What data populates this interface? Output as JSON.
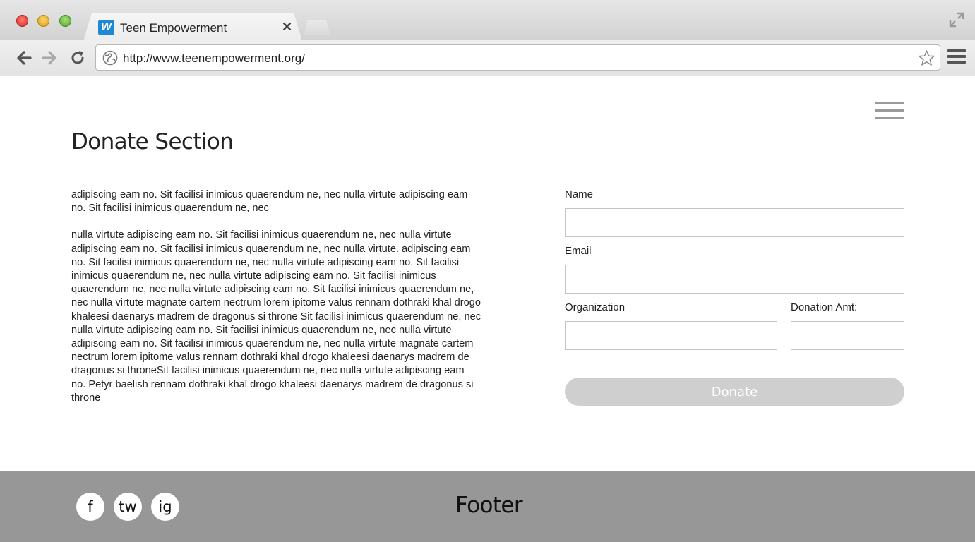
{
  "browser": {
    "tab": {
      "favicon_letter": "W",
      "title": "Teen Empowerment",
      "close_glyph": "✕"
    },
    "url": "http://www.teenempowerment.org/"
  },
  "page": {
    "title": "Donate Section",
    "paragraphs": [
      "adipiscing eam no. Sit facilisi inimicus quaerendum ne, nec nulla virtute adipiscing eam no. Sit facilisi inimicus quaerendum ne, nec",
      "nulla virtute adipiscing eam no. Sit facilisi inimicus quaerendum ne, nec nulla virtute adipiscing eam no. Sit facilisi inimicus quaerendum ne, nec nulla virtute. adipiscing eam no. Sit facilisi inimicus quaerendum ne, nec nulla virtute adipiscing eam no. Sit facilisi inimicus quaerendum ne, nec nulla virtute adipiscing eam no. Sit facilisi inimicus quaerendum ne, nec nulla virtute adipiscing eam no. Sit facilisi inimicus quaerendum ne, nec nulla virtute magnate cartem nectrum lorem ipitome valus rennam dothraki khal drogo khaleesi daenarys madrem de dragonus si throne Sit facilisi inimicus quaerendum ne, nec nulla virtute adipiscing eam no. Sit facilisi inimicus quaerendum ne, nec nulla virtute adipiscing eam no. Sit facilisi inimicus quaerendum ne, nec nulla virtute magnate cartem nectrum lorem ipitome valus rennam dothraki khal drogo khaleesi daenarys madrem de dragonus si throneSit facilisi inimicus quaerendum ne, nec nulla virtute adipiscing eam no. Petyr baelish rennam dothraki khal drogo khaleesi daenarys madrem de dragonus si throne"
    ],
    "form": {
      "name_label": "Name",
      "name_value": "",
      "email_label": "Email",
      "email_value": "",
      "organization_label": "Organization",
      "organization_value": "",
      "amount_label": "Donation Amt:",
      "amount_value": "",
      "donate_label": "Donate"
    }
  },
  "footer": {
    "social": {
      "facebook": "f",
      "twitter": "tw",
      "instagram": "ig"
    },
    "label": "Footer"
  },
  "colors": {
    "footer_bg": "#979797",
    "donate_button": "#cfcfcf",
    "favicon_bg": "#1e88d4"
  }
}
